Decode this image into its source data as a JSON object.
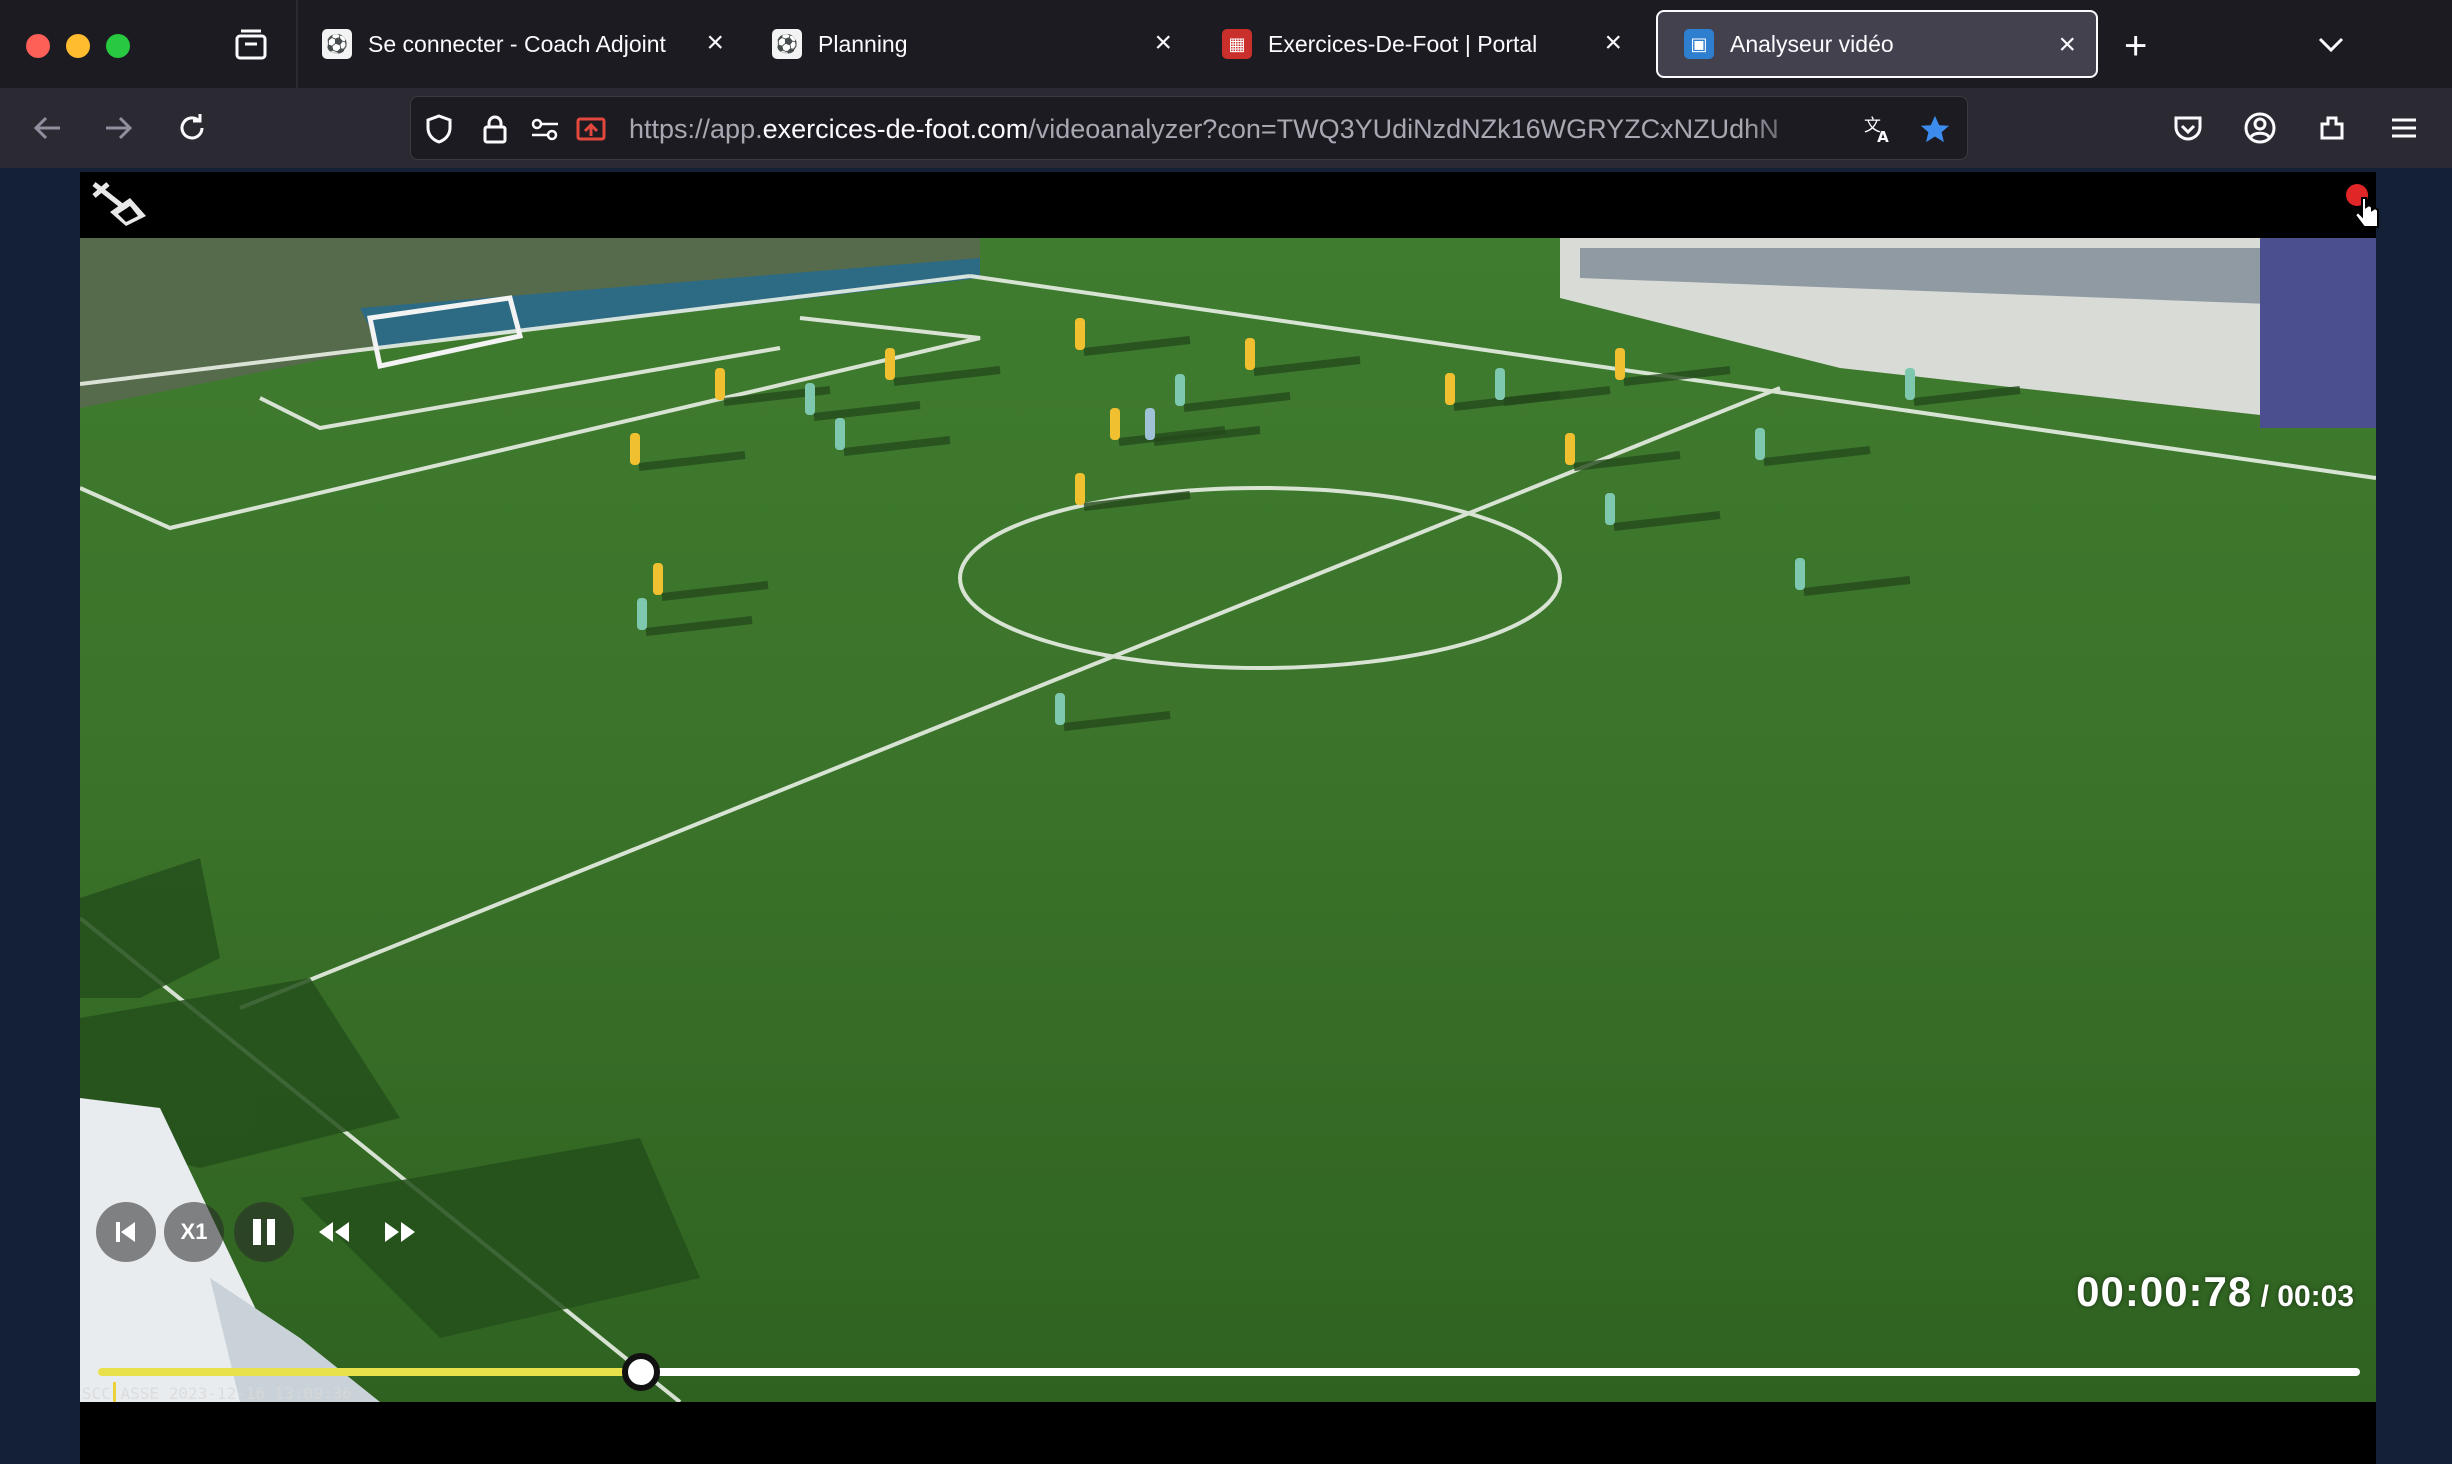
{
  "tabs": [
    {
      "title": "Se connecter - Coach Adjoint",
      "favicon": "coach-adjoint-favicon",
      "active": false
    },
    {
      "title": "Planning",
      "favicon": "coach-adjoint-favicon",
      "active": false
    },
    {
      "title": "Exercices-De-Foot | Portal",
      "favicon": "exercices-de-foot-favicon",
      "active": false
    },
    {
      "title": "Analyseur vidéo",
      "favicon": "video-analyzer-favicon",
      "active": true
    }
  ],
  "urlbar": {
    "scheme": "https://app.",
    "host": "exercices-de-foot.com",
    "path": "/videoanalyzer?con=TWQ3YUdiNzdNZk16WGRYZCxNZUdhN"
  },
  "player": {
    "speed_label": "X1",
    "current_time": "00:00:78",
    "total_time": " / 00:03",
    "progress": 0.24,
    "timestamp_overlay": "SCC ASSE  2023-12-16  13:09:36",
    "recording_indicator": "red"
  },
  "icons": {
    "back": "arrow-left-icon",
    "forward": "arrow-right-icon",
    "reload": "reload-icon",
    "tracking_protection": "shield-icon",
    "secure": "lock-icon",
    "permissions": "permissions-icon",
    "bookmark": "star-icon",
    "translate": "translate-icon"
  },
  "colors": {
    "accent_yellow": "#e9e14b",
    "bookmark_blue": "#3b8ced",
    "record_red": "#e02626"
  }
}
